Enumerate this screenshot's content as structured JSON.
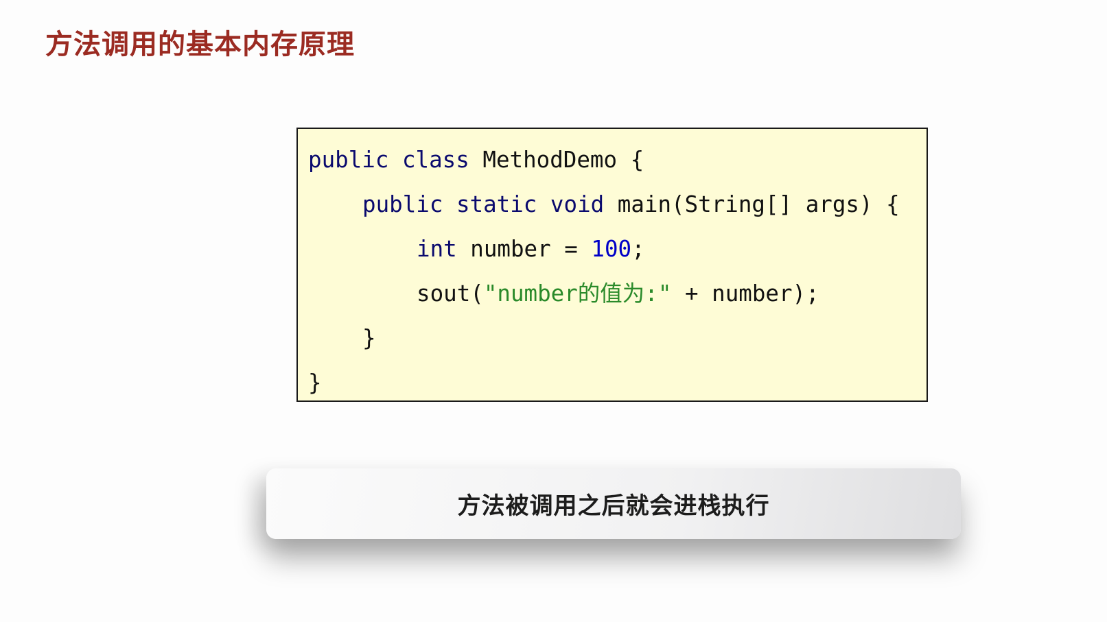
{
  "title": "方法调用的基本内存原理",
  "code": {
    "line1": {
      "kw": "public class",
      "rest": " MethodDemo {"
    },
    "line2": {
      "kw": "public static void",
      "rest": " main(String[] args) {"
    },
    "line3": {
      "kw": "int",
      "mid": " number = ",
      "num": "100",
      "end": ";"
    },
    "line4": {
      "pre": "sout(",
      "str": "\"number的值为:\"",
      "end": " + number);"
    },
    "line5": "}",
    "line6": "}"
  },
  "banner": "方法被调用之后就会进栈执行",
  "colors": {
    "title": "#9b2b22",
    "code_bg": "#fefcd6",
    "keyword": "#0a0a6e",
    "number": "#0000c8",
    "string": "#2a8a2a"
  }
}
